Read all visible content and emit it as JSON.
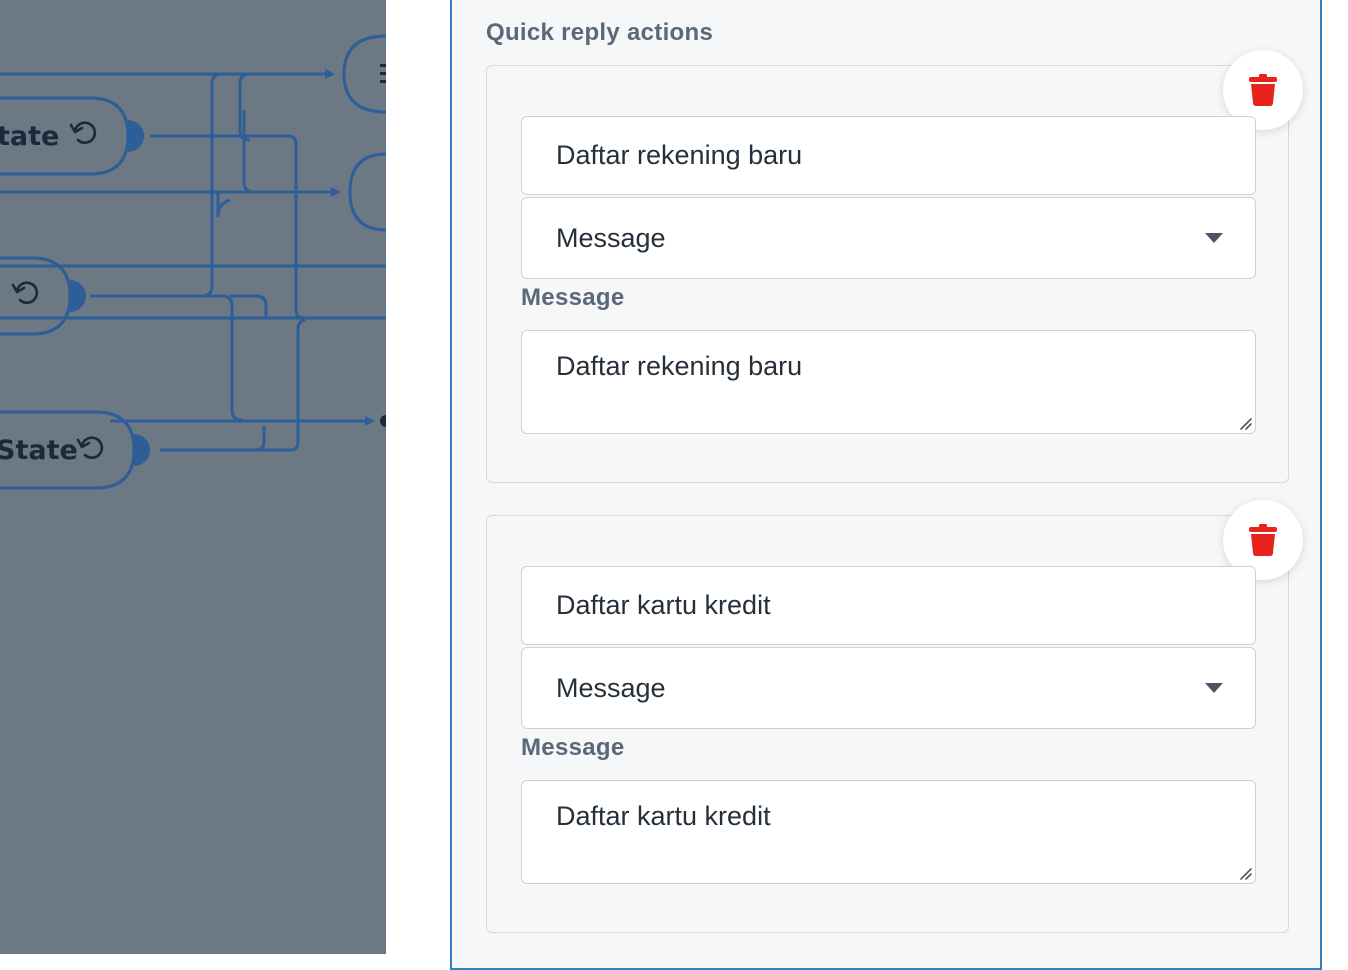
{
  "canvas": {
    "background": "#6c7884",
    "edge_color": "#2d5e98",
    "nodes": [
      {
        "label": "tate",
        "icon": "reset-icon"
      },
      {
        "label": "",
        "icon": "reset-icon"
      },
      {
        "label": "State",
        "icon": "reset-icon"
      }
    ]
  },
  "panel": {
    "section_title": "Quick reply actions",
    "accent": "#2f7fc5",
    "delete_icon_color": "#e8221c",
    "quick_replies": [
      {
        "title": "Daftar rekening baru",
        "type": "Message",
        "message_label": "Message",
        "message": "Daftar rekening baru"
      },
      {
        "title": "Daftar kartu kredit",
        "type": "Message",
        "message_label": "Message",
        "message": "Daftar kartu kredit"
      }
    ]
  }
}
